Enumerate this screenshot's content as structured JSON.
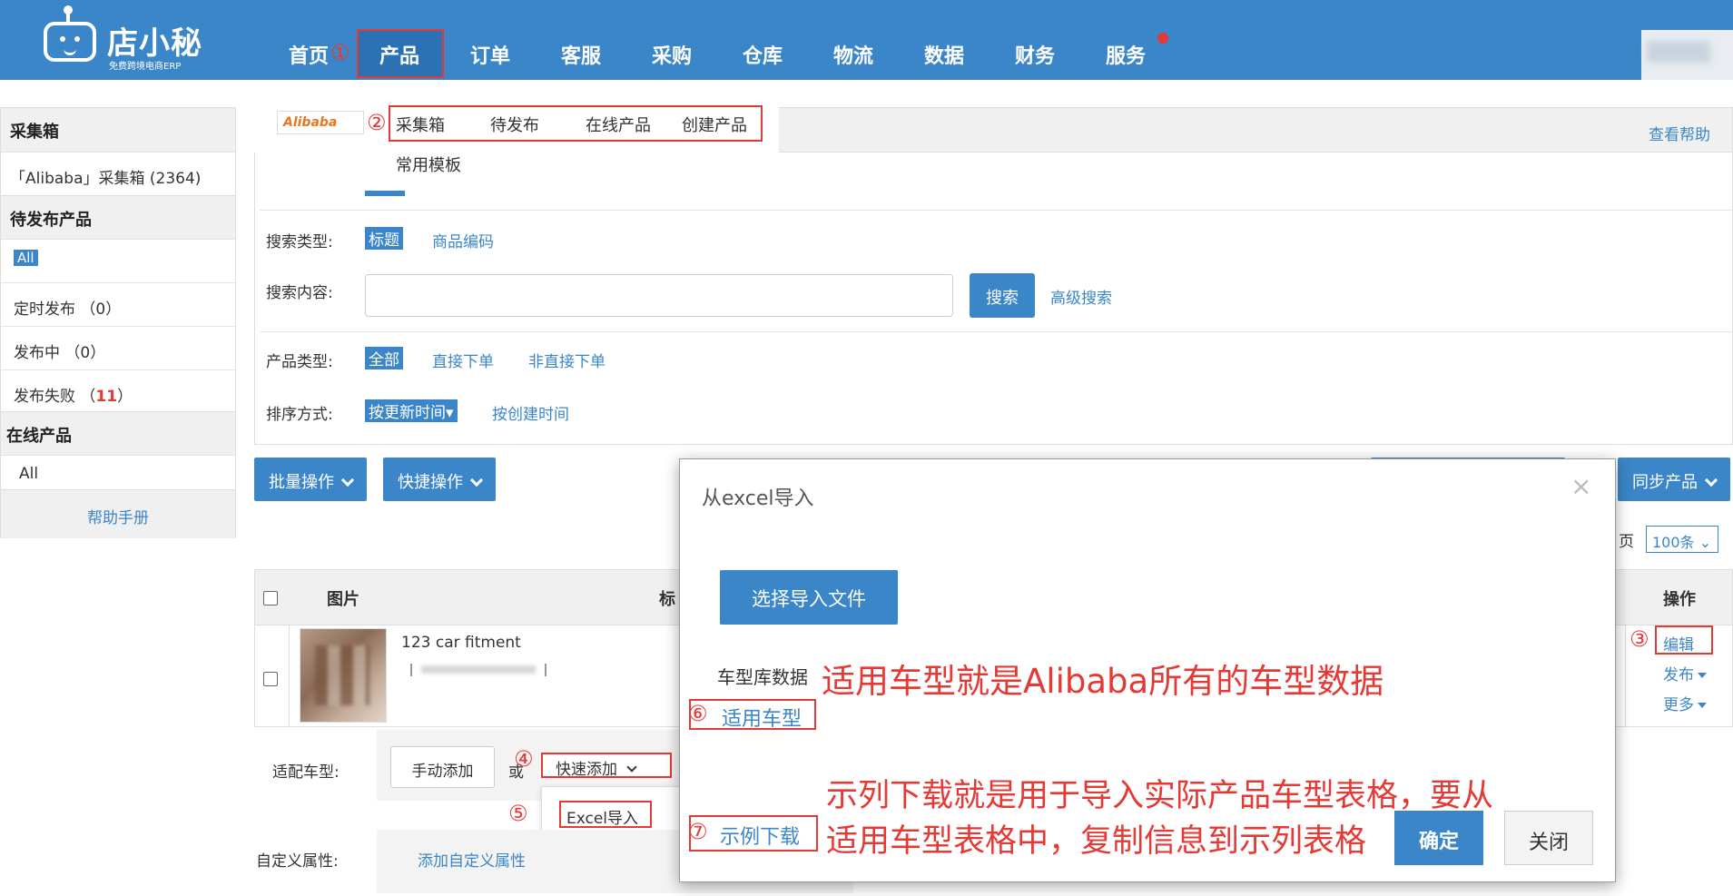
{
  "app": {
    "logo_name": "店小秘",
    "logo_sub": "免费跨境电商ERP"
  },
  "nav": [
    "首页",
    "产品",
    "订单",
    "客服",
    "采购",
    "仓库",
    "物流",
    "数据",
    "财务",
    "服务"
  ],
  "markers": {
    "m1": "①",
    "m2": "②",
    "m3": "③",
    "m4": "④",
    "m5": "⑤",
    "m6": "⑥",
    "m7": "⑦"
  },
  "sidebar": {
    "collect_head": "采集箱",
    "collect_item": "「Alibaba」采集箱 (2364)",
    "pending_head": "待发布产品",
    "pending_all": "All",
    "scheduled": "定时发布 （0）",
    "publishing": "发布中 （0）",
    "failed_label": "发布失败 （",
    "failed_count": "11",
    "failed_close": "）",
    "online_head": "在线产品",
    "online_all": "All",
    "help": "帮助手册"
  },
  "subnav": {
    "platform_logo": "Alibaba",
    "tabs": [
      "采集箱",
      "待发布",
      "在线产品",
      "创建产品"
    ],
    "extra": "常用模板",
    "help": "查看帮助"
  },
  "filters": {
    "search_type_label": "搜索类型:",
    "search_type_opts": [
      "标题",
      "商品编码"
    ],
    "search_content_label": "搜索内容:",
    "search_btn": "搜索",
    "advanced": "高级搜索",
    "product_type_label": "产品类型:",
    "product_type_opts": [
      "全部",
      "直接下单",
      "非直接下单"
    ],
    "sort_label": "排序方式:",
    "sort_opts": [
      "按更新时间▾",
      "按创建时间"
    ]
  },
  "toolbar": {
    "batch": "批量操作",
    "quick": "快捷操作",
    "sync": "同步产品",
    "page_label": "页",
    "page_size": "100条 ⌄"
  },
  "table": {
    "headers": {
      "image": "图片",
      "title": "标",
      "ops": "操作"
    },
    "row": {
      "title": "123 car fitment",
      "edit": "编辑",
      "publish": "发布",
      "more": "更多"
    }
  },
  "form": {
    "fitment_label": "适配车型:",
    "manual_add": "手动添加",
    "or": "或",
    "quick_add": "快速添加",
    "excel_import": "Excel导入",
    "custom_label": "自定义属性:",
    "custom_add": "添加自定义属性"
  },
  "modal": {
    "title": "从excel导入",
    "close": "×",
    "choose_file": "选择导入文件",
    "carlib_label": "车型库数据",
    "fit_link": "适用车型",
    "sample_link": "示例下载",
    "ok": "确定",
    "cancel": "关闭"
  },
  "notes": {
    "n1": "适用车型就是Alibaba所有的车型数据",
    "n2": "示列下载就是用于导入实际产品车型表格，要从",
    "n3": "适用车型表格中，复制信息到示列表格"
  },
  "colors": {
    "brand": "#3b86c8",
    "annotation": "#e53935"
  }
}
